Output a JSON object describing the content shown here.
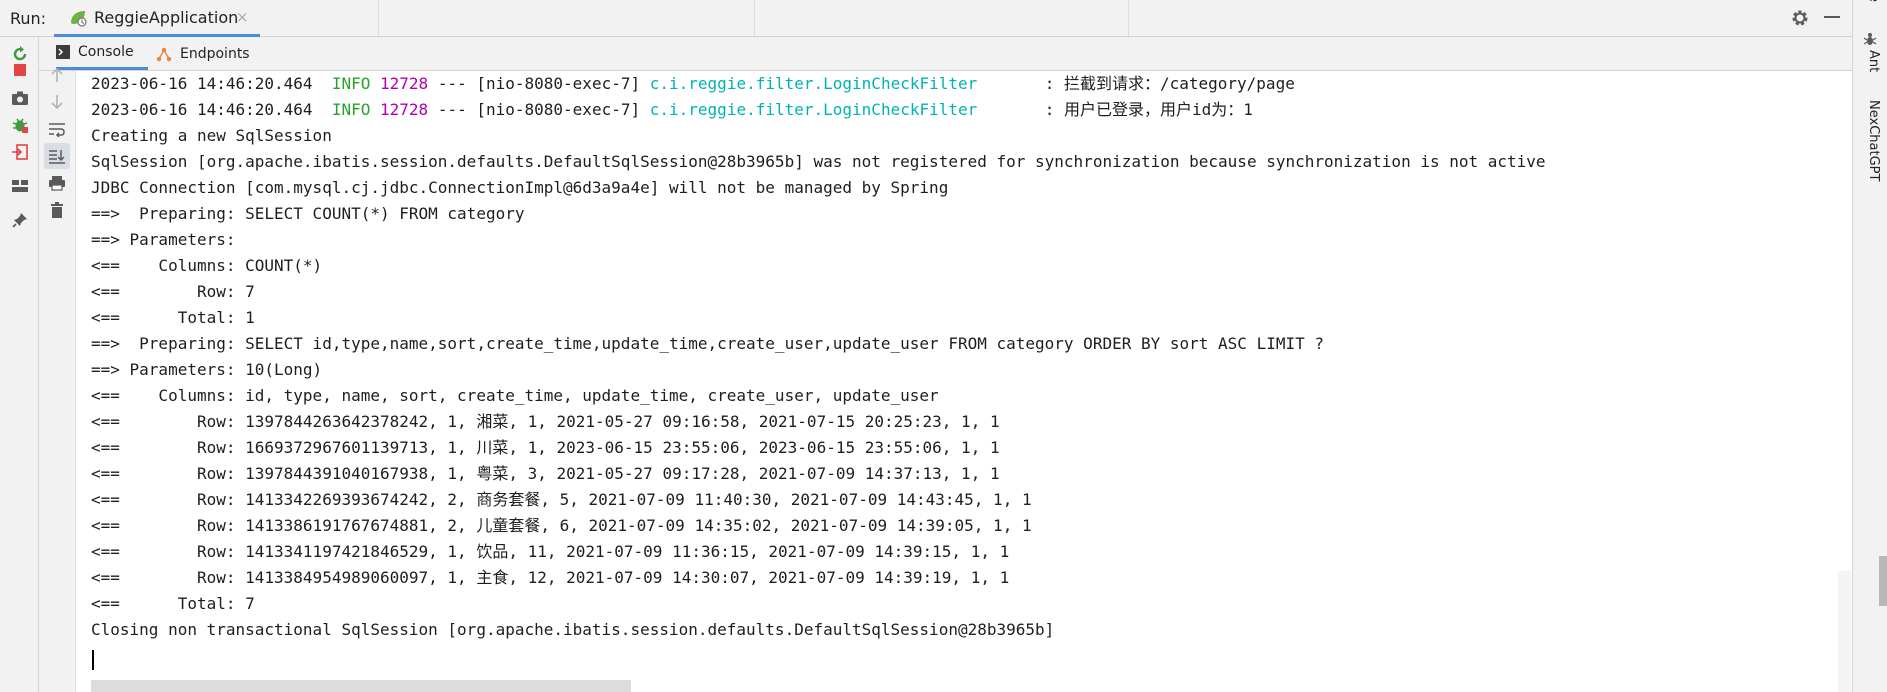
{
  "runbar": {
    "label": "Run:",
    "tab_title": "ReggieApplication",
    "tab_close": "×"
  },
  "subtabs": {
    "console": "Console",
    "endpoints": "Endpoints"
  },
  "right_strip": {
    "top_label": "e",
    "ant": "Ant",
    "nexchat": "NexChatGPT"
  },
  "colors": {
    "accent": "#4a8cd6",
    "info_level": "#29a329",
    "pid": "#b000b0",
    "logger": "#00b3b3",
    "rerun_icon": "#3d9a3d",
    "stop_icon": "#e04444"
  },
  "console": {
    "log1": {
      "ts": "2023-06-16 14:46:20.464",
      "level": "INFO",
      "pid": "12728",
      "thread": "--- [nio-8080-exec-7]",
      "logger": "c.i.reggie.filter.LoginCheckFilter",
      "msg": ": 拦截到请求：/category/page"
    },
    "log2": {
      "ts": "2023-06-16 14:46:20.464",
      "level": "INFO",
      "pid": "12728",
      "thread": "--- [nio-8080-exec-7]",
      "logger": "c.i.reggie.filter.LoginCheckFilter",
      "msg": ": 用户已登录，用户id为：1"
    },
    "lines": [
      "Creating a new SqlSession",
      "SqlSession [org.apache.ibatis.session.defaults.DefaultSqlSession@28b3965b] was not registered for synchronization because synchronization is not active",
      "JDBC Connection [com.mysql.cj.jdbc.ConnectionImpl@6d3a9a4e] will not be managed by Spring",
      "==>  Preparing: SELECT COUNT(*) FROM category",
      "==> Parameters: ",
      "<==    Columns: COUNT(*)",
      "<==        Row: 7",
      "<==      Total: 1",
      "==>  Preparing: SELECT id,type,name,sort,create_time,update_time,create_user,update_user FROM category ORDER BY sort ASC LIMIT ?",
      "==> Parameters: 10(Long)",
      "<==    Columns: id, type, name, sort, create_time, update_time, create_user, update_user",
      "<==        Row: 1397844263642378242, 1, 湘菜, 1, 2021-05-27 09:16:58, 2021-07-15 20:25:23, 1, 1",
      "<==        Row: 1669372967601139713, 1, 川菜, 1, 2023-06-15 23:55:06, 2023-06-15 23:55:06, 1, 1",
      "<==        Row: 1397844391040167938, 1, 粤菜, 3, 2021-05-27 09:17:28, 2021-07-09 14:37:13, 1, 1",
      "<==        Row: 1413342269393674242, 2, 商务套餐, 5, 2021-07-09 11:40:30, 2021-07-09 14:43:45, 1, 1",
      "<==        Row: 1413386191767674881, 2, 儿童套餐, 6, 2021-07-09 14:35:02, 2021-07-09 14:39:05, 1, 1",
      "<==        Row: 1413341197421846529, 1, 饮品, 11, 2021-07-09 11:36:15, 2021-07-09 14:39:15, 1, 1",
      "<==        Row: 1413384954989060097, 1, 主食, 12, 2021-07-09 14:30:07, 2021-07-09 14:39:19, 1, 1",
      "<==      Total: 7",
      "Closing non transactional SqlSession [org.apache.ibatis.session.defaults.DefaultSqlSession@28b3965b]"
    ]
  }
}
